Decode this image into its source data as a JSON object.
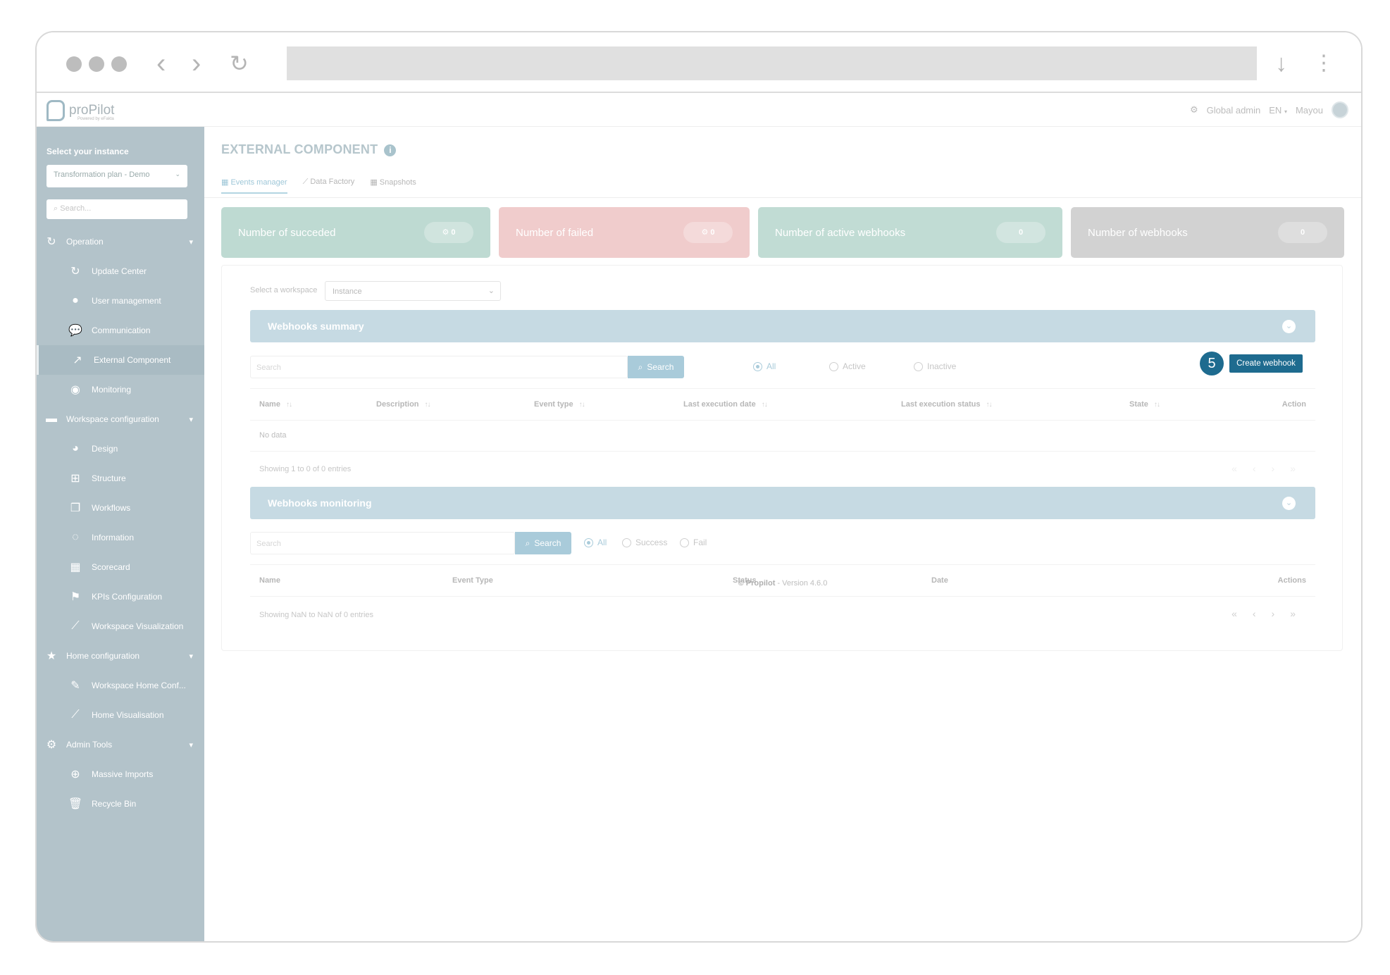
{
  "app": {
    "logo_text": "proPilot",
    "logo_sub": "Powered by eFakta"
  },
  "topbar": {
    "global_admin": "Global admin",
    "language": "EN",
    "user": "Mayou"
  },
  "sidebar": {
    "instance_label": "Select your instance",
    "instance_value": "Transformation plan - Demo",
    "search_placeholder": "Search...",
    "groups": [
      {
        "label": "Operation",
        "items": [
          "Update Center",
          "User management",
          "Communication",
          "External Component",
          "Monitoring"
        ]
      },
      {
        "label": "Workspace configuration",
        "items": [
          "Design",
          "Structure",
          "Workflows",
          "Information",
          "Scorecard",
          "KPIs Configuration",
          "Workspace Visualization"
        ]
      },
      {
        "label": "Home configuration",
        "items": [
          "Workspace Home Conf...",
          "Home Visualisation"
        ]
      },
      {
        "label": "Admin Tools",
        "items": [
          "Massive Imports",
          "Recycle Bin"
        ]
      }
    ]
  },
  "page": {
    "title": "EXTERNAL COMPONENT",
    "tabs": [
      "Events manager",
      "Data Factory",
      "Snapshots"
    ]
  },
  "stats": [
    {
      "label": "Number of succeded",
      "value": "0",
      "color": "#bedad2"
    },
    {
      "label": "Number of failed",
      "value": "0",
      "color": "#f0cccc"
    },
    {
      "label": "Number of active webhooks",
      "value": "0",
      "color": "#c1dcd4"
    },
    {
      "label": "Number of webhooks",
      "value": "0",
      "color": "#d2d2d2"
    }
  ],
  "workspace": {
    "label": "Select a workspace",
    "value": "Instance"
  },
  "summary": {
    "title": "Webhooks summary",
    "search_placeholder": "Search",
    "search_button": "Search",
    "filters": [
      "All",
      "Active",
      "Inactive"
    ],
    "step_badge": "5",
    "create_button": "Create webhook",
    "columns": [
      "Name",
      "Description",
      "Event type",
      "Last execution date",
      "Last execution status",
      "State",
      "Action"
    ],
    "no_data": "No data",
    "showing": "Showing 1 to 0 of 0 entries"
  },
  "monitoring": {
    "title": "Webhooks monitoring",
    "search_placeholder": "Search",
    "search_button": "Search",
    "filters": [
      "All",
      "Success",
      "Fail"
    ],
    "columns": [
      "Name",
      "Event Type",
      "Status",
      "Date",
      "Actions"
    ],
    "showing": "Showing NaN to NaN of 0 entries"
  },
  "pager": [
    "«",
    "‹",
    "›",
    "»"
  ],
  "footer": {
    "brand": "© Propilot",
    "version": " - Version 4.6.0"
  }
}
